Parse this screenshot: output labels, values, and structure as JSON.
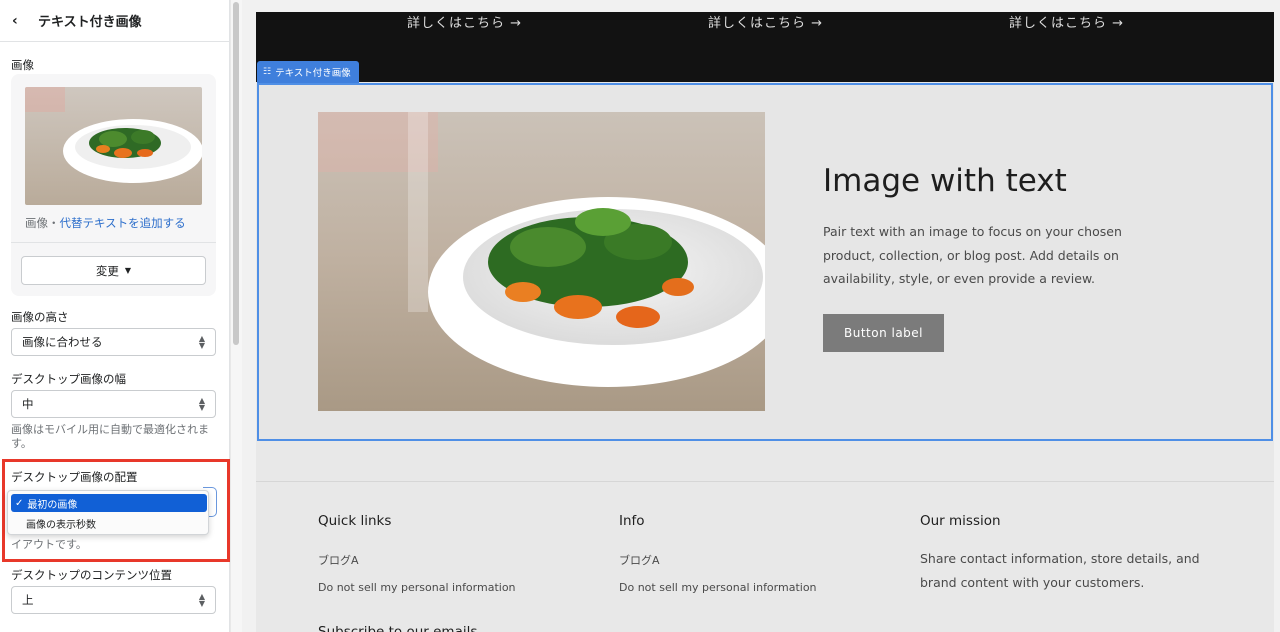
{
  "sidebar": {
    "title": "テキスト付き画像",
    "image_label": "画像",
    "image_caption_prefix": "画像・",
    "image_caption_link": "代替テキストを追加する",
    "change_button": "変更",
    "height_label": "画像の高さ",
    "height_value": "画像に合わせる",
    "width_label": "デスクトップ画像の幅",
    "width_value": "中",
    "width_help": "画像はモバイル用に自動で最適化されます。",
    "placement_label": "デスクトップ画像の配置",
    "placement_options": [
      "最初の画像",
      "画像の表示秒数"
    ],
    "placement_selected": "最初の画像",
    "placement_help_visible": "イアウトです。",
    "content_position_label": "デスクトップのコンテンツ位置",
    "content_position_value": "上"
  },
  "preview": {
    "learn_more": [
      "詳しくはこちら →",
      "詳しくはこちら →",
      "詳しくはこちら →"
    ],
    "section_tag": "テキスト付き画像",
    "hero_title": "Image with text",
    "hero_body": "Pair text with an image to focus on your chosen product, collection, or blog post. Add details on availability, style, or even provide a review.",
    "hero_button": "Button label",
    "footer": {
      "col1_heading": "Quick links",
      "col1_links": [
        "ブログA",
        "Do not sell my personal information"
      ],
      "col2_heading": "Info",
      "col2_links": [
        "ブログA",
        "Do not sell my personal information"
      ],
      "col3_heading": "Our mission",
      "col3_text": "Share contact information, store details, and brand content with your customers.",
      "cut_heading": "Subscribe to our emails"
    }
  },
  "colors": {
    "accent_blue": "#3f7fdc",
    "highlight_red": "#e8382a",
    "dark_band": "#121212",
    "button_gray": "#7b7b7b"
  }
}
